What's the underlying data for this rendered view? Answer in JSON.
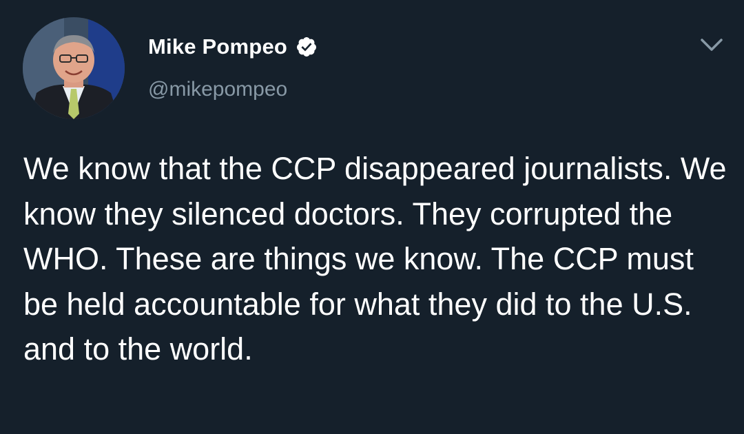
{
  "tweet": {
    "author": {
      "display_name": "Mike Pompeo",
      "handle": "@mikepompeo",
      "verified": true
    },
    "text": "We know that the CCP disappeared journalists. We know they silenced doctors. They corrupted the WHO. These are things we know. The CCP must be held accountable for what they did to the U.S. and to the world."
  },
  "icons": {
    "verified": "verified-badge-icon",
    "menu": "chevron-down-icon"
  },
  "colors": {
    "background": "#15202b",
    "primary_text": "#ffffff",
    "secondary_text": "#8899a6",
    "accent": "#1da1f2"
  }
}
